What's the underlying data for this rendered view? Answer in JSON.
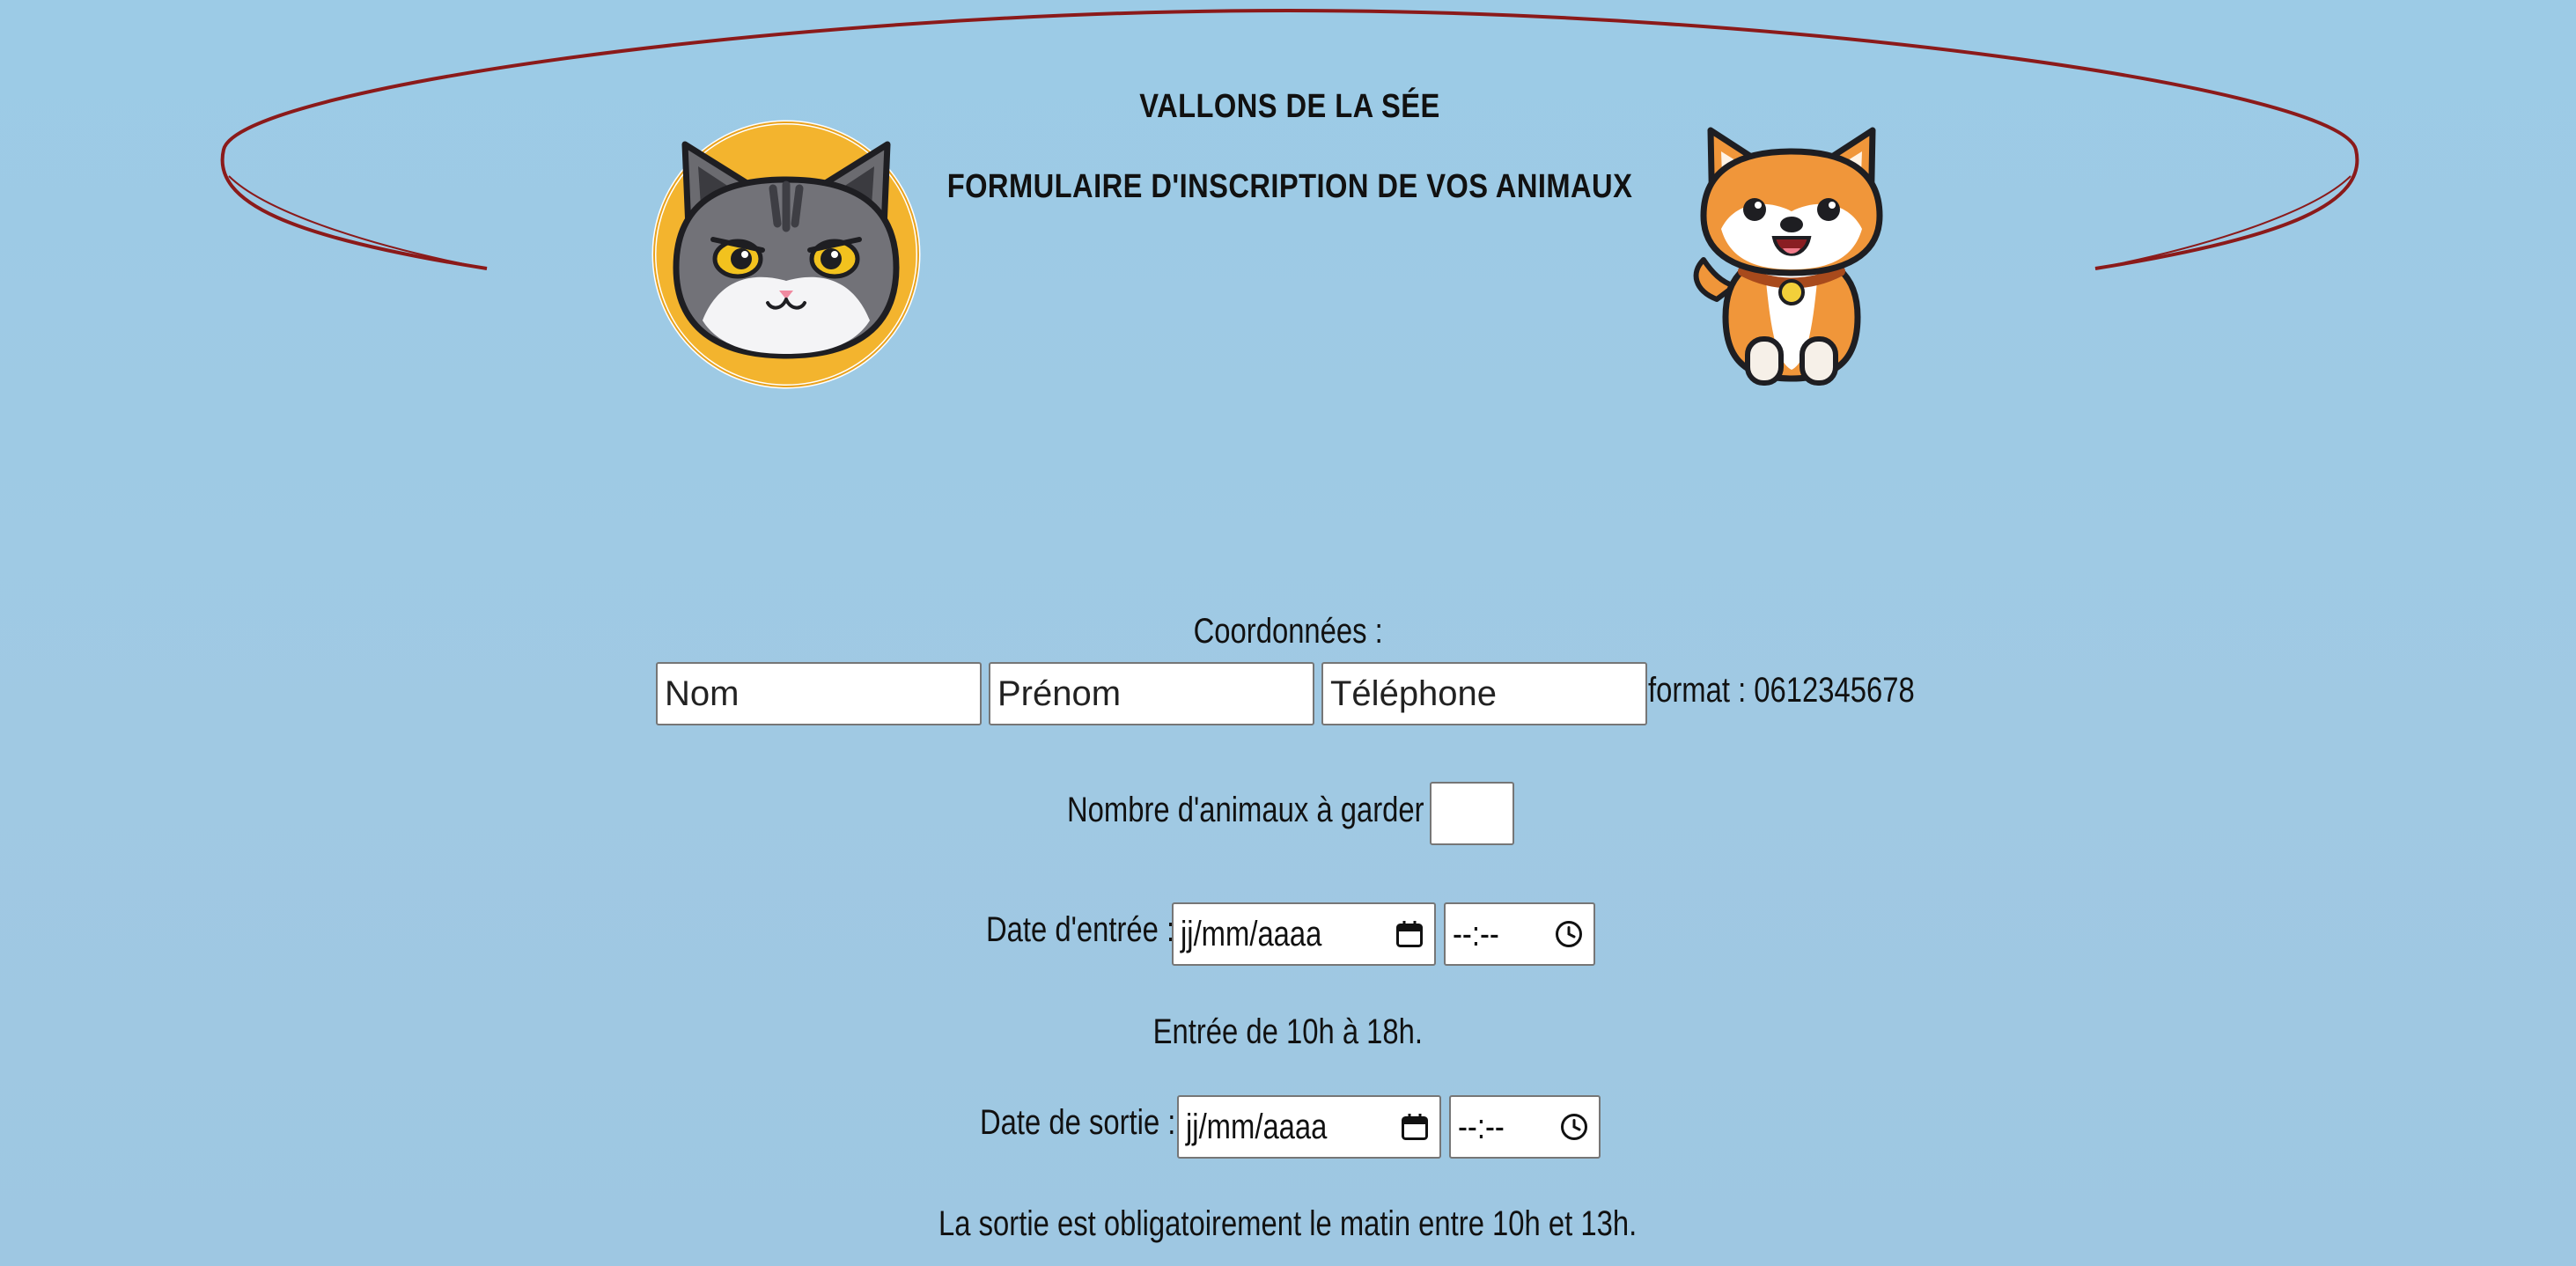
{
  "header": {
    "title": "VALLONS DE LA SÉE",
    "subtitle": "FORMULAIRE D'INSCRIPTION DE VOS ANIMAUX"
  },
  "form": {
    "contact_label": "Coordonnées :",
    "nom_placeholder": "Nom",
    "prenom_placeholder": "Prénom",
    "telephone_placeholder": "Téléphone",
    "telephone_hint": "format : 0612345678",
    "animals_count_label": "Nombre d'animaux à garder :",
    "animals_count_value": "",
    "entry_date_label": "Date d'entrée :",
    "entry_date_value": "jj/mm/aaaa",
    "entry_time_value": "--:--",
    "entry_hours_note": "Entrée de 10h à 18h.",
    "exit_date_label": "Date de sortie :",
    "exit_date_value": "jj/mm/aaaa",
    "exit_time_value": "--:--",
    "exit_hours_note": "La sortie est obligatoirement le matin entre 10h et 13h."
  },
  "icons": {
    "calendar": "calendar-icon",
    "clock": "clock-icon",
    "cat": "cat-illustration",
    "dog": "dog-illustration"
  },
  "colors": {
    "background": "#9ecae4",
    "arc_stroke": "#8b1a1a",
    "cat_circle": "#f5b731",
    "dog_fur": "#f0963a"
  }
}
